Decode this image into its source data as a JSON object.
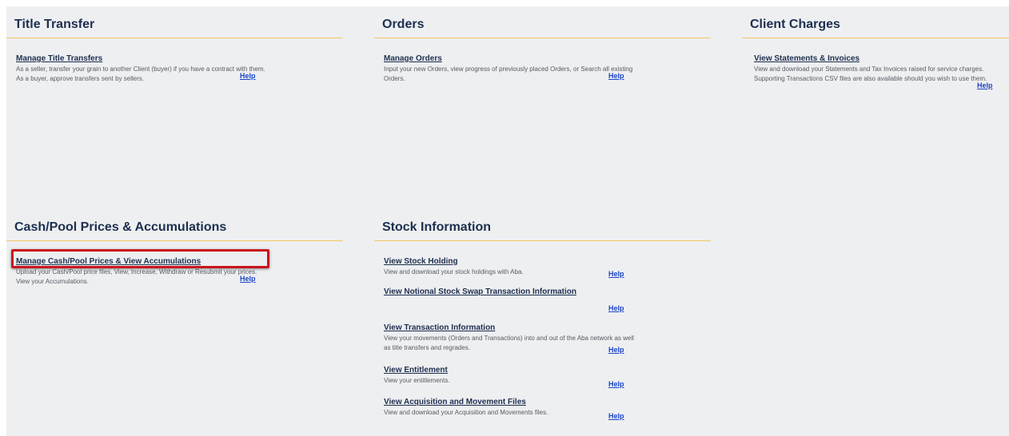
{
  "sections": {
    "title_transfer": {
      "title": "Title Transfer",
      "items": [
        {
          "link": "Manage Title Transfers",
          "desc": "As a seller, transfer your grain to another Client (buyer) if you have a contract with them. As a buyer, approve transfers sent by sellers.",
          "help": "Help"
        }
      ]
    },
    "orders": {
      "title": "Orders",
      "items": [
        {
          "link": "Manage Orders",
          "desc": "Input your new Orders, view progress of previously placed Orders, or Search all existing Orders.",
          "help": "Help"
        }
      ]
    },
    "client_charges": {
      "title": "Client Charges",
      "items": [
        {
          "link": "View Statements & Invoices",
          "desc": "View and download your Statements and Tax Invoices raised for service charges. Supporting Transactions CSV files are also available should you wish to use them.",
          "help": "Help"
        }
      ]
    },
    "cash_pool": {
      "title": "Cash/Pool Prices & Accumulations",
      "items": [
        {
          "link": "Manage Cash/Pool Prices & View Accumulations",
          "desc": "Upload your Cash/Pool price files, View, Increase, Withdraw or Resubmit your prices. View your Accumulations.",
          "help": "Help"
        }
      ]
    },
    "stock_information": {
      "title": "Stock Information",
      "items": [
        {
          "link": "View Stock Holding",
          "desc": "View and download your stock holdings with Aba.",
          "help": "Help"
        },
        {
          "link": "View Notional Stock Swap Transaction Information",
          "desc": "",
          "help": "Help"
        },
        {
          "link": "View Transaction Information",
          "desc": "View your movements (Orders and Transactions) into and out of the Aba network as well as title transfers and regrades.",
          "help": "Help"
        },
        {
          "link": "View Entitlement",
          "desc": "View your entitlements.",
          "help": "Help"
        },
        {
          "link": "View Acquisition and Movement Files",
          "desc": "View and download your Acquisition and Movements files.",
          "help": "Help"
        }
      ]
    }
  },
  "colors": {
    "background": "#eeeff1",
    "title": "#1d2f4f",
    "divider": "#f1c865",
    "help_link": "#1b44c7",
    "highlight": "#c9161c"
  }
}
